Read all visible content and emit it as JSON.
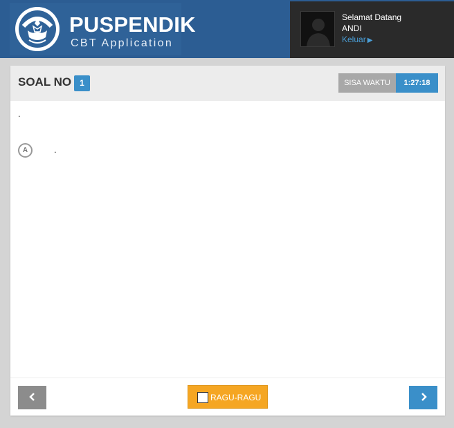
{
  "header": {
    "brand_title": "PUSPENDIK",
    "brand_subtitle": "CBT Application",
    "logo_motto": "TUT WURI HANDAYANI",
    "greeting": "Selamat Datang",
    "username": "ANDI",
    "logout_label": "Keluar"
  },
  "question_panel": {
    "label": "SOAL NO",
    "number": "1",
    "time_label": "SISA WAKTU",
    "time_remaining": "1:27:18",
    "question_text": ".",
    "options": [
      {
        "letter": "A",
        "text": "."
      }
    ]
  },
  "footer": {
    "doubt_label": "RAGU-RAGU",
    "doubt_checked": false
  },
  "colors": {
    "header_bg": "#2c5d93",
    "accent_blue": "#3a8fc9",
    "doubt_orange": "#f5a623",
    "prev_gray": "#8c8c8c"
  }
}
